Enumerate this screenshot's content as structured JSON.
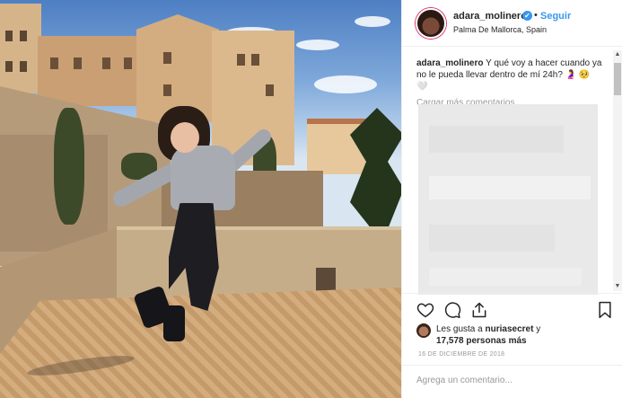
{
  "post": {
    "username": "adara_molinero",
    "verified_mark": "✔",
    "separator": "•",
    "follow_label": "Seguir",
    "location": "Palma De Mallorca, Spain"
  },
  "caption": {
    "username": "adara_molinero",
    "text": "Y qué voy a hacer cuando ya no le pueda llevar dentro de mí 24h? 🤰 🥺 🤍"
  },
  "comments": {
    "load_more_label": "Cargar más comentarios"
  },
  "scrollbar": {
    "up_arrow": "▲",
    "down_arrow": "▼"
  },
  "actions": {
    "icons": [
      "heart-icon",
      "comment-icon",
      "share-icon",
      "bookmark-icon"
    ]
  },
  "likes": {
    "prefix": "Les gusta a",
    "first_liker": "nuriasecret",
    "conjunction": "y",
    "count_text": "17,578 personas más"
  },
  "date": "16 DE DICIEMBRE DE 2018",
  "comment_box": {
    "placeholder": "Agrega un comentario..."
  },
  "colors": {
    "link_blue": "#3897f0",
    "text": "#262626",
    "muted": "#999999",
    "border": "#efefef"
  }
}
